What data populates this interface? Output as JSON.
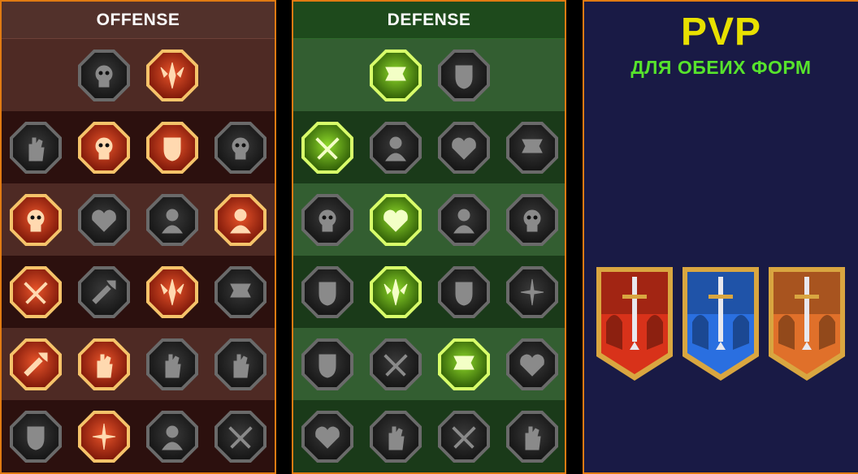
{
  "offense": {
    "title": "OFFENSE",
    "rows": [
      [
        {
          "icon": "crossed-swords-icon",
          "active": false
        },
        {
          "icon": "slashing-blades-icon",
          "active": true
        }
      ],
      [
        {
          "icon": "horned-demon-icon",
          "active": false
        },
        {
          "icon": "sword-burst-icon",
          "active": true
        },
        {
          "icon": "bursting-heart-icon",
          "active": true
        },
        {
          "icon": "cracked-heart-icon",
          "active": false
        }
      ],
      [
        {
          "icon": "arrows-pierced-figure-icon",
          "active": true
        },
        {
          "icon": "fanged-maw-icon",
          "active": false
        },
        {
          "icon": "skull-cloak-icon",
          "active": false
        },
        {
          "icon": "scythe-hand-icon",
          "active": true
        }
      ],
      [
        {
          "icon": "bleeding-sword-icon",
          "active": true
        },
        {
          "icon": "fist-hammer-icon",
          "active": false
        },
        {
          "icon": "axe-strike-icon",
          "active": true
        },
        {
          "icon": "lightning-chains-icon",
          "active": false
        }
      ],
      [
        {
          "icon": "arrow-volley-icon",
          "active": true
        },
        {
          "icon": "triple-skull-icon",
          "active": true
        },
        {
          "icon": "dagger-shield-icon",
          "active": false
        },
        {
          "icon": "muscled-figure-icon",
          "active": false
        }
      ],
      [
        {
          "icon": "sparkling-sword-icon",
          "active": false
        },
        {
          "icon": "flaming-helmet-icon",
          "active": true
        },
        {
          "icon": "horned-beast-icon",
          "active": false
        },
        {
          "icon": "spiked-skull-icon",
          "active": false
        }
      ]
    ]
  },
  "defense": {
    "title": "DEFENSE",
    "rows": [
      [
        {
          "icon": "armor-plates-icon",
          "active": true
        },
        {
          "icon": "raised-fist-icon",
          "active": false
        }
      ],
      [
        {
          "icon": "shield-chevrons-icon",
          "active": true
        },
        {
          "icon": "heart-organ-icon",
          "active": false
        },
        {
          "icon": "armored-golem-icon",
          "active": false
        },
        {
          "icon": "crossed-blades-icon",
          "active": false
        }
      ],
      [
        {
          "icon": "healer-silhouette-icon",
          "active": false
        },
        {
          "icon": "knight-shield-icon",
          "active": true
        },
        {
          "icon": "heart-skull-icon",
          "active": false
        },
        {
          "icon": "hooded-head-icon",
          "active": false
        }
      ],
      [
        {
          "icon": "crowd-figures-icon",
          "active": false
        },
        {
          "icon": "hourglass-sun-icon",
          "active": true
        },
        {
          "icon": "open-palm-icon",
          "active": false
        },
        {
          "icon": "bull-head-icon",
          "active": false
        }
      ],
      [
        {
          "icon": "dashing-runner-icon",
          "active": false
        },
        {
          "icon": "claw-marks-icon",
          "active": false
        },
        {
          "icon": "radiant-skull-icon",
          "active": true
        },
        {
          "icon": "deflect-hand-icon",
          "active": false
        }
      ],
      [
        {
          "icon": "crowned-warrior-icon",
          "active": false
        },
        {
          "icon": "winged-shield-icon",
          "active": false
        },
        {
          "icon": "bearded-warrior-icon",
          "active": false
        },
        {
          "icon": "flexing-figure-icon",
          "active": false
        }
      ]
    ]
  },
  "pvp": {
    "title": "PVP",
    "subtitle": "ДЛЯ ОБЕИХ ФОРМ",
    "banners": [
      {
        "icon": "red-knights-sword-banner-icon",
        "accent": "#d8321a"
      },
      {
        "icon": "blue-triple-swords-banner-icon",
        "accent": "#2a6fe0"
      },
      {
        "icon": "crossed-swords-knights-banner-icon",
        "accent": "#e0702a"
      }
    ]
  },
  "colors": {
    "border": "#e07a12",
    "offense_active": "#e8542a",
    "defense_active": "#8fd92a",
    "pvp_title": "#e8e000",
    "pvp_subtitle": "#57e32c"
  }
}
